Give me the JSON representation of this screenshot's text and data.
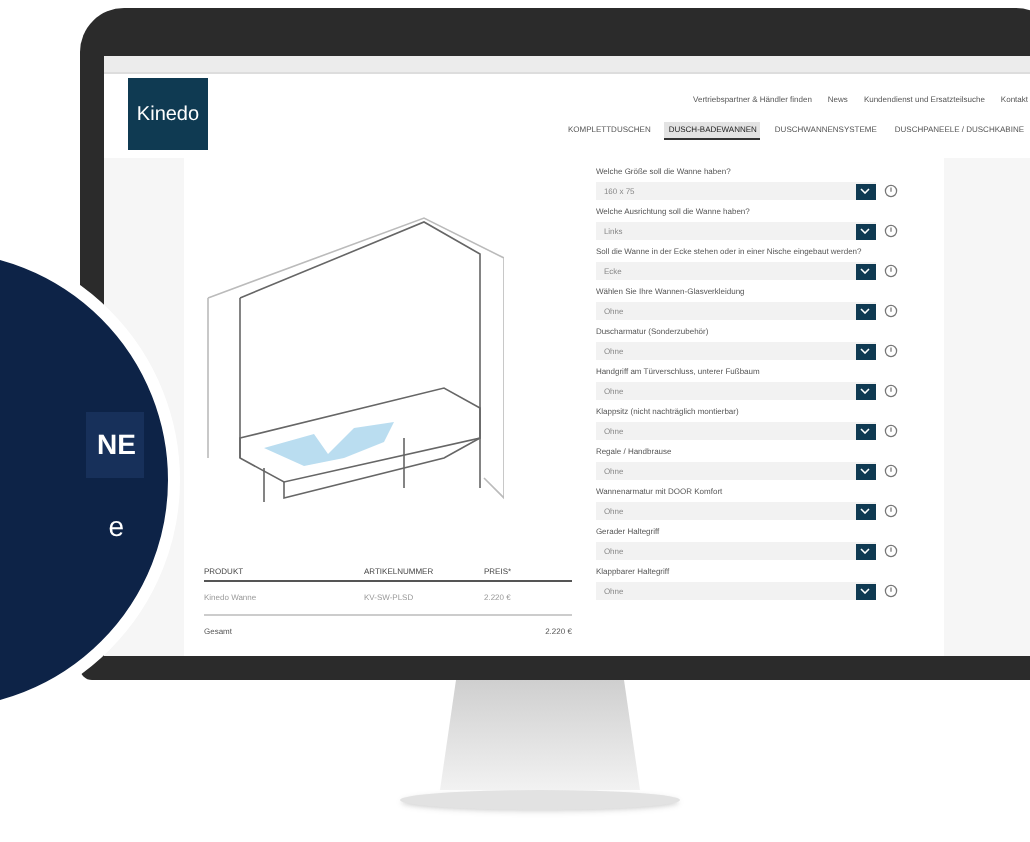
{
  "header": {
    "logo": "Kinedo",
    "top_links": [
      "Vertriebspartner & Händler finden",
      "News",
      "Kundendienst und Ersatzteilsuche",
      "Kontakt"
    ],
    "nav": [
      {
        "label": "KOMPLETTDUSCHEN",
        "selected": false
      },
      {
        "label": "DUSCH-BADEWANNEN",
        "selected": true
      },
      {
        "label": "DUSCHWANNENSYSTEME",
        "selected": false
      },
      {
        "label": "DUSCHPANEELE / DUSCHKABINE",
        "selected": false
      }
    ]
  },
  "form": {
    "fields": [
      {
        "label": "Welche Größe soll die Wanne haben?",
        "value": "160 x 75"
      },
      {
        "label": "Welche Ausrichtung soll die Wanne haben?",
        "value": "Links"
      },
      {
        "label": "Soll die Wanne in der Ecke stehen oder in einer Nische eingebaut werden?",
        "value": "Ecke"
      },
      {
        "label": "Wählen Sie Ihre Wannen-Glasverkleidung",
        "value": "Ohne"
      },
      {
        "label": "Duscharmatur (Sonderzubehör)",
        "value": "Ohne"
      },
      {
        "label": "Handgriff am Türverschluss, unterer Fußbaum",
        "value": "Ohne"
      },
      {
        "label": "Klappsitz (nicht nachträglich montierbar)",
        "value": "Ohne"
      },
      {
        "label": "Regale / Handbrause",
        "value": "Ohne"
      },
      {
        "label": "Wannenarmatur mit DOOR Komfort",
        "value": "Ohne"
      },
      {
        "label": "Gerader Haltegriff",
        "value": "Ohne"
      },
      {
        "label": "Klappbarer Haltegriff",
        "value": "Ohne"
      }
    ]
  },
  "summary": {
    "columns": [
      "PRODUKT",
      "ARTIKELNUMMER",
      "PREIS*"
    ],
    "rows": [
      [
        "Kinedo Wanne",
        "KV-SW-PLSD",
        "2.220 €"
      ]
    ],
    "total": {
      "label": "Gesamt",
      "value": "2.220 €"
    }
  },
  "badge": {
    "lines": [
      "NE",
      "e"
    ]
  }
}
